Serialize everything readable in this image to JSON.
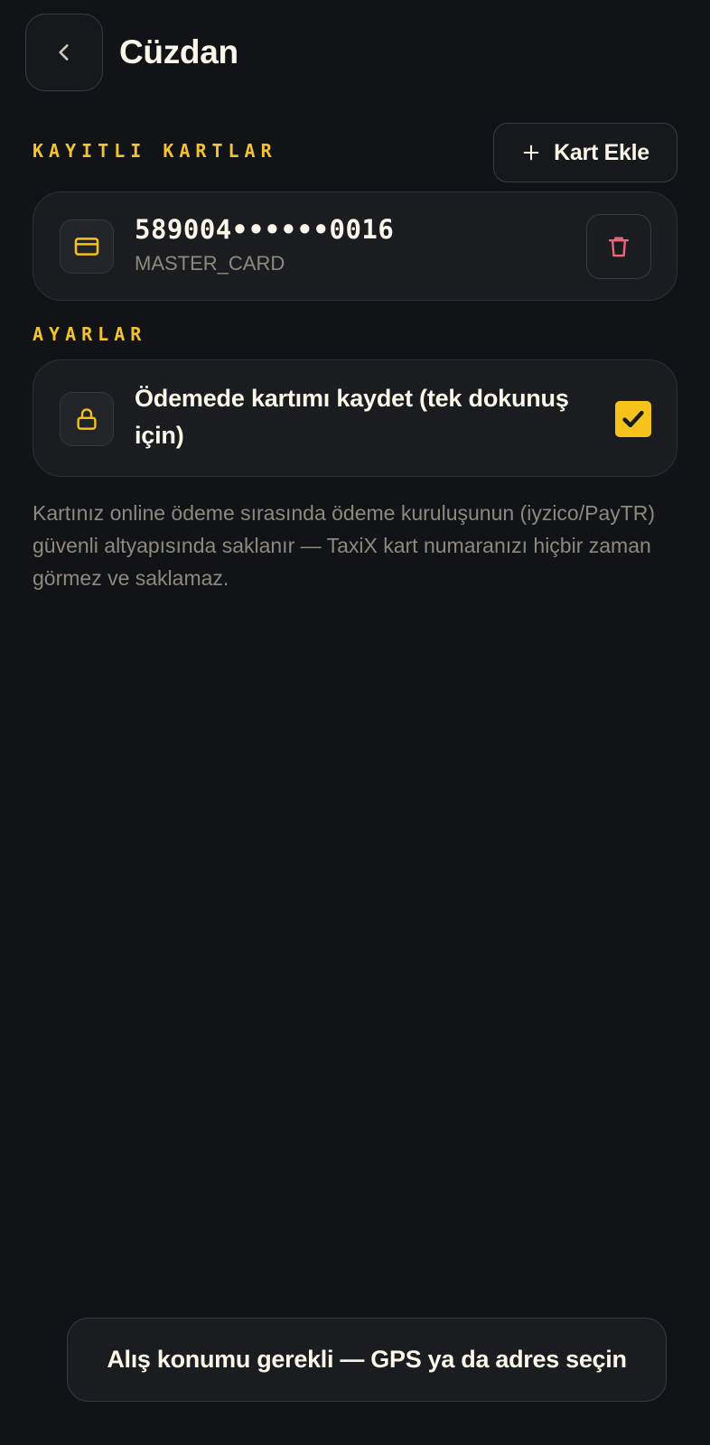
{
  "colors": {
    "background": "#121317",
    "accent": "#f6c21c",
    "danger": "#e86a7a",
    "muted_text": "#8d897f"
  },
  "header": {
    "title": "Cüzdan",
    "back_icon": "chevron-left-icon"
  },
  "saved_cards": {
    "section_label": "KAYITLI KARTLAR",
    "add_button_label": "Kart Ekle",
    "add_button_icon": "plus-icon",
    "items": [
      {
        "number": "589004••••••0016",
        "brand": "MASTER_CARD",
        "icon": "credit-card-icon",
        "delete_icon": "trash-icon"
      }
    ]
  },
  "settings": {
    "section_label": "AYARLAR",
    "save_card_label": "Ödemede kartımı kaydet (tek dokunuş için)",
    "save_card_icon": "lock-icon",
    "save_card_checked": true
  },
  "info": {
    "text": "Kartınız online ödeme sırasında ödeme kuruluşunun (iyzico/PayTR) güvenli altyapısında saklanır — TaxiX kart numaranızı hiçbir zaman görmez ve saklamaz."
  },
  "toast": {
    "text": "Alış konumu gerekli — GPS ya da adres seçin"
  }
}
